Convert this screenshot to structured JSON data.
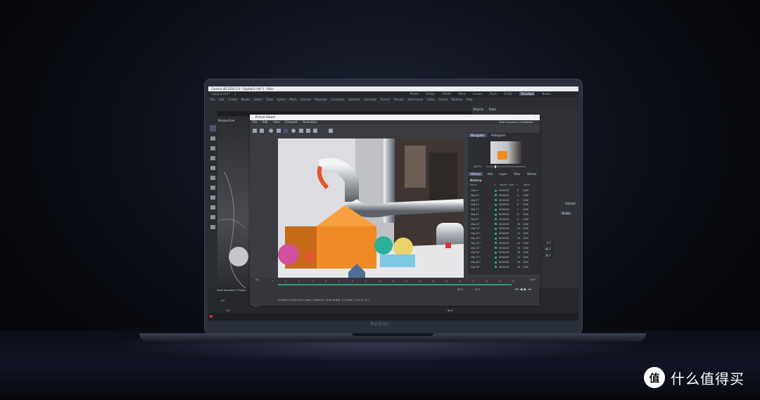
{
  "app": {
    "title": "Cinema 4D 2024.2.0 - [laptop3.c4d *] - Main",
    "doc_tab": "laptop3.c4d *",
    "layouts": [
      "Model",
      "Sculpt",
      "UVEdit",
      "Paint",
      "Groom",
      "Track",
      "Script",
      "Standard",
      "Nodes"
    ],
    "active_layout": "Standard",
    "menu": [
      "File",
      "Edit",
      "Create",
      "Modes",
      "Select",
      "Tools",
      "Spline",
      "Mesh",
      "Volume",
      "Mograph",
      "Character",
      "Animate",
      "Simulate",
      "Tracker",
      "Render",
      "Extensions",
      "V-Ray",
      "Arnold",
      "Window",
      "Help"
    ],
    "viewport_label": "Perspective",
    "viewport_menu": [
      "View",
      "Cameras"
    ],
    "right_tabs": [
      "Objects",
      "Takes"
    ],
    "view_transform_left": "View Transform: Project",
    "timeline_values": [
      "0 F",
      "0 F",
      "100 %",
      "90 F"
    ]
  },
  "picture_viewer": {
    "title": "Picture Viewer",
    "menu": [
      "File",
      "Edit",
      "View",
      "Compare",
      "Animation"
    ],
    "view_transform": "View Transform: Embedded",
    "nav_tabs": [
      "Navigator",
      "Histogram"
    ],
    "zoom": "100 %",
    "hist_tabs": [
      "History",
      "Info",
      "Layer",
      "Filter",
      "Stereo"
    ],
    "history_heading": "History",
    "history_columns": [
      "Name",
      "R",
      "Render Time",
      "F",
      "Resol"
    ],
    "history_rows": [
      {
        "name": "20g 3 *",
        "time": "00:00:00",
        "f": "3",
        "res": "1200"
      },
      {
        "name": "20g 4 *",
        "time": "00:00:00",
        "f": "4",
        "res": "1200"
      },
      {
        "name": "20g 5 *",
        "time": "00:00:00",
        "f": "5",
        "res": "1200"
      },
      {
        "name": "20g 6 *",
        "time": "00:00:00",
        "f": "6",
        "res": "1200"
      },
      {
        "name": "20g 7 *",
        "time": "00:00:00",
        "f": "7",
        "res": "1200"
      },
      {
        "name": "20g 8 *",
        "time": "00:00:00",
        "f": "8",
        "res": "1200"
      },
      {
        "name": "20g 9 *",
        "time": "00:00:00",
        "f": "9",
        "res": "1200"
      },
      {
        "name": "20g 10 *",
        "time": "00:00:00",
        "f": "10",
        "res": "1200"
      },
      {
        "name": "20g 11 *",
        "time": "00:00:00",
        "f": "11",
        "res": "1200"
      },
      {
        "name": "20g 12 *",
        "time": "00:00:00",
        "f": "12",
        "res": "1200"
      },
      {
        "name": "20g 13 *",
        "time": "00:00:00",
        "f": "13",
        "res": "1200"
      },
      {
        "name": "20g 14 *",
        "time": "00:00:00",
        "f": "14",
        "res": "1200"
      },
      {
        "name": "20g 15 *",
        "time": "00:00:00",
        "f": "15",
        "res": "1200"
      },
      {
        "name": "20g 16 *",
        "time": "00:00:00",
        "f": "16",
        "res": "1200"
      },
      {
        "name": "20g 17 *",
        "time": "00:00:00",
        "f": "17",
        "res": "1200"
      },
      {
        "name": "20g 18 *",
        "time": "00:00:00",
        "f": "18",
        "res": "1200"
      },
      {
        "name": "20g 19 *",
        "time": "00:00:00",
        "f": "19",
        "res": "1200"
      }
    ],
    "ruler_ticks": [
      "1",
      "2",
      "3",
      "4",
      "5",
      "6",
      "7",
      "8",
      "9",
      "10",
      "11",
      "12",
      "13",
      "14",
      "15",
      "16",
      "17",
      "18",
      "19",
      "20"
    ],
    "frame_start": "0 F",
    "frame_current": "20 F",
    "frame_end": "20 F",
    "frame_field": "21 F",
    "info": "00:00:01 21/21 (20 F)   Size: 1280x720, RGB (8 Bit), 3.70 MB,  ( F 21 of 21 )"
  },
  "right_fields": [
    "Default",
    "Bullet",
    "0 F",
    "90 F",
    "30 F"
  ],
  "laptop_brand": "Redmi",
  "watermark": {
    "text": "什么值得买",
    "logo_char": "值"
  },
  "colors": {
    "accent": "#4b5376",
    "render_orange": "#f08a24",
    "status_green": "#27c46a"
  }
}
